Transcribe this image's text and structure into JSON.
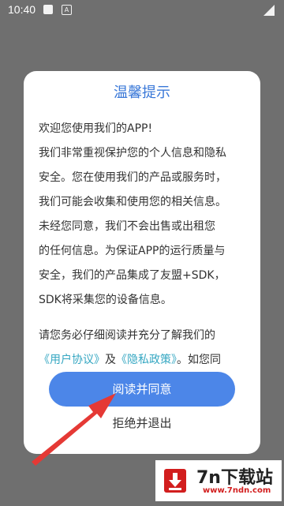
{
  "status_bar": {
    "time": "10:40",
    "a_icon": "A"
  },
  "dialog": {
    "title": "温馨提示",
    "lines": [
      "欢迎您使用我们的APP!",
      "我们非常重视保护您的个人信息和隐私",
      "安全。您在使用我们的产品或服务时，",
      "我们可能会收集和使用您的相关信息。",
      "未经您同意，我们不会出售或出租您",
      "的任何信息。为保证APP的运行质量与",
      "安全，我们的产品集成了友盟+SDK，",
      "SDK将采集您的设备信息。"
    ],
    "read_line": "请您务必仔细阅读并充分了解我们的",
    "user_agreement": "《用户协议》",
    "and_text": "及",
    "privacy_policy": "《隐私政策》",
    "tail_text": "。如您同",
    "agree_label": "阅读并同意",
    "decline_label": "拒绝并退出"
  },
  "watermark": {
    "text": "7n下载站",
    "url": "www.7ndn.com"
  },
  "colors": {
    "accent": "#3a78d8",
    "button": "#4c86e8",
    "link": "#35a7c2",
    "arrow": "#e53935"
  }
}
